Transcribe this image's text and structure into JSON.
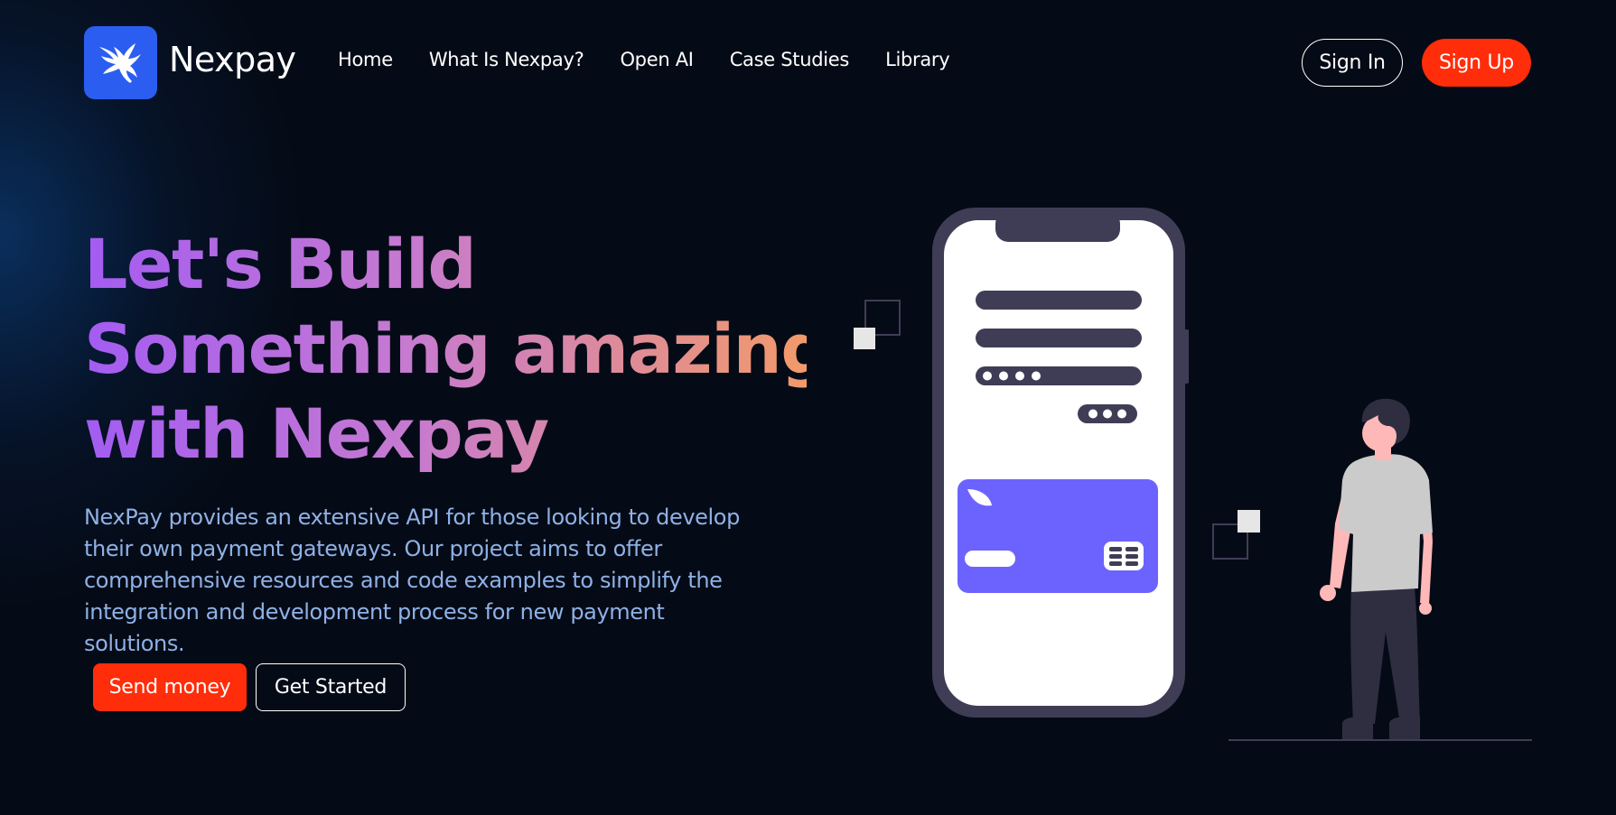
{
  "brand": {
    "name": "Nexpay",
    "logo_icon": "eagle-icon",
    "logo_color": "#2b5ef0"
  },
  "nav": {
    "links": [
      {
        "label": "Home"
      },
      {
        "label": "What Is Nexpay?"
      },
      {
        "label": "Open AI"
      },
      {
        "label": "Case Studies"
      },
      {
        "label": "Library"
      }
    ],
    "sign_in": "Sign In",
    "sign_up": "Sign Up"
  },
  "hero": {
    "headline_lines": [
      "Let's Build",
      "Something amazing",
      "with Nexpay"
    ],
    "description": "NexPay provides an extensive API for those looking to develop their own payment gateways. Our project aims to offer comprehensive resources and code examples to simplify the integration and development process for new payment solutions.",
    "primary_button": "Send money",
    "secondary_button": "Get Started"
  },
  "colors": {
    "accent": "#ff2d0a",
    "background": "#050b16",
    "card": "#6c63ff",
    "headline_gradient": [
      "#a35cf2",
      "#c67ad0",
      "#f29a6a"
    ],
    "description_text": "#8fb1e6"
  }
}
